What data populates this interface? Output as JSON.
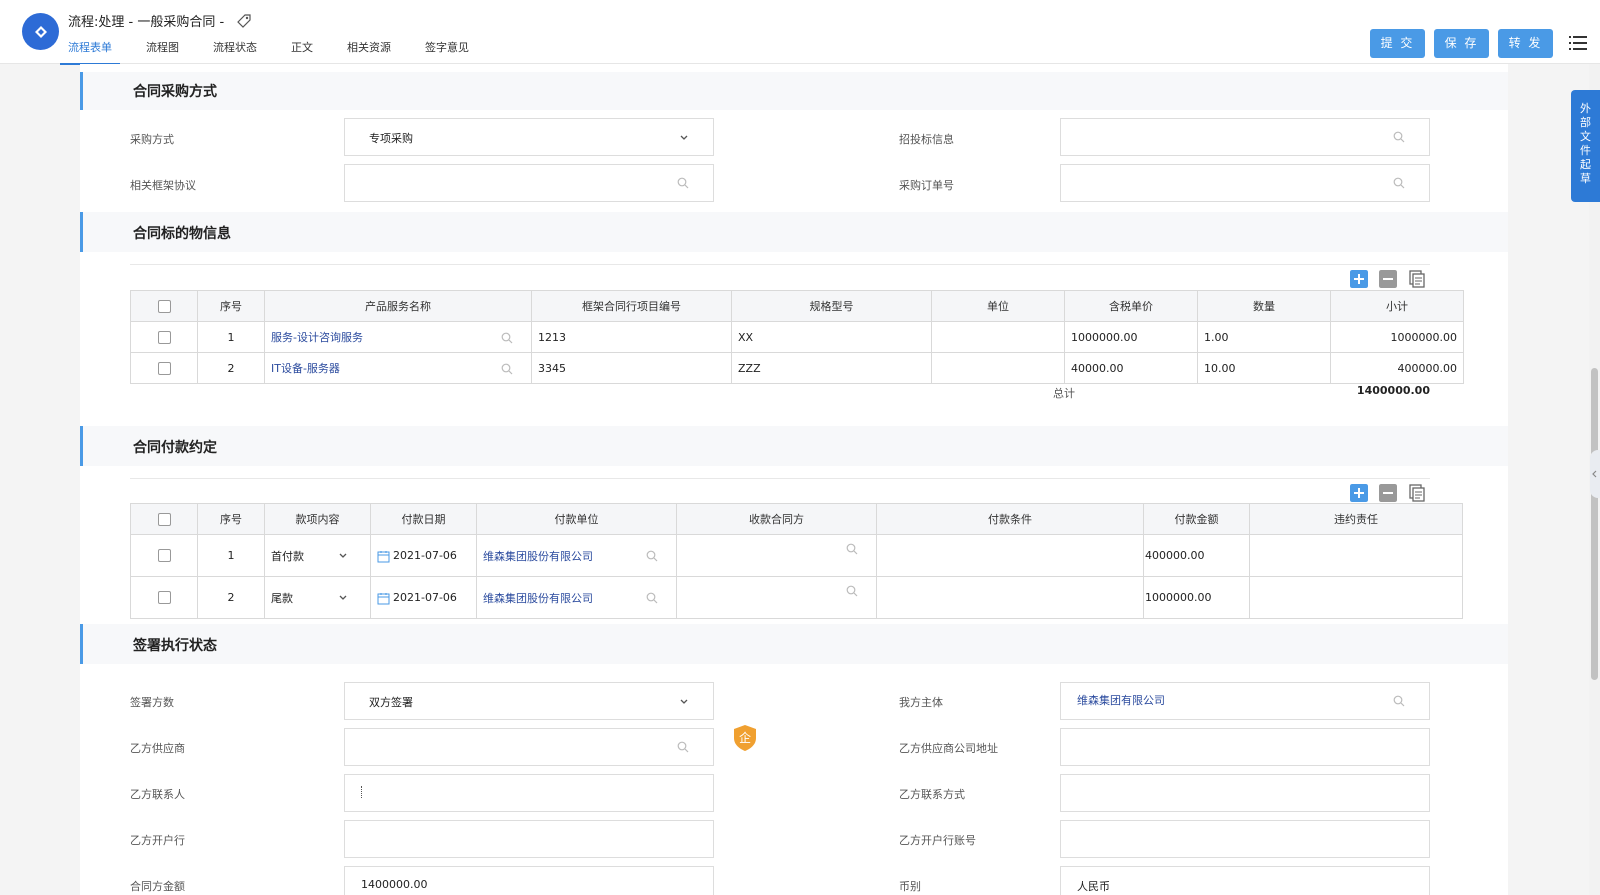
{
  "header": {
    "title": "流程:处理 - 一般采购合同 -",
    "tabs": [
      "流程表单",
      "流程图",
      "流程状态",
      "正文",
      "相关资源",
      "签字意见"
    ],
    "buttons": {
      "submit": "提 交",
      "save": "保 存",
      "forward": "转 发"
    }
  },
  "side_tab": "外部文件起草",
  "sections": {
    "purchase": {
      "title": "合同采购方式",
      "method_label": "采购方式",
      "method_value": "专项采购",
      "bid_label": "招投标信息",
      "framework_label": "相关框架协议",
      "order_label": "采购订单号"
    },
    "subject": {
      "title": "合同标的物信息",
      "columns": [
        "序号",
        "产品服务名称",
        "框架合同行项目编号",
        "规格型号",
        "单位",
        "含税单价",
        "数量",
        "小计"
      ],
      "rows": [
        {
          "no": "1",
          "name": "服务-设计咨询服务",
          "item_no": "1213",
          "spec": "XX",
          "unit": "",
          "price": "1000000.00",
          "qty": "1.00",
          "subtotal": "1000000.00"
        },
        {
          "no": "2",
          "name": "IT设备-服务器",
          "item_no": "3345",
          "spec": "ZZZ",
          "unit": "",
          "price": "40000.00",
          "qty": "10.00",
          "subtotal": "400000.00"
        }
      ],
      "total_label": "总计",
      "total_value": "1400000.00"
    },
    "payment": {
      "title": "合同付款约定",
      "columns": [
        "序号",
        "款项内容",
        "付款日期",
        "付款单位",
        "收款合同方",
        "付款条件",
        "付款金额",
        "违约责任"
      ],
      "rows": [
        {
          "no": "1",
          "content": "首付款",
          "date": "2021-07-06",
          "payer": "维森集团股份有限公司",
          "payee": "",
          "condition": "",
          "amount": "400000.00",
          "liability": ""
        },
        {
          "no": "2",
          "content": "尾款",
          "date": "2021-07-06",
          "payer": "维森集团股份有限公司",
          "payee": "",
          "condition": "",
          "amount": "1000000.00",
          "liability": ""
        }
      ]
    },
    "signing": {
      "title": "签署执行状态",
      "parties_label": "签署方数",
      "parties_value": "双方签署",
      "our_entity_label": "我方主体",
      "our_entity_value": "维森集团有限公司",
      "supplier_label": "乙方供应商",
      "supplier_address_label": "乙方供应商公司地址",
      "contact_label": "乙方联系人",
      "contact_method_label": "乙方联系方式",
      "bank_label": "乙方开户行",
      "bank_account_label": "乙方开户行账号",
      "amount_label": "合同方金额",
      "amount_value": "1400000.00",
      "currency_label": "币别",
      "currency_value": "人民币",
      "badge": "企"
    }
  },
  "colors": {
    "accent": "#4a9ae6",
    "link": "#2b4b9e",
    "badge": "#f0a030"
  }
}
